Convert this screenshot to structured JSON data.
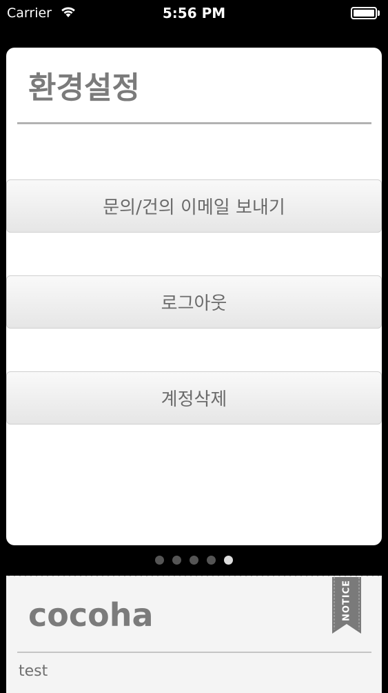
{
  "status_bar": {
    "carrier": "Carrier",
    "time": "5:56 PM"
  },
  "settings": {
    "title": "환경설정",
    "buttons": [
      {
        "label": "문의/건의 이메일 보내기"
      },
      {
        "label": "로그아웃"
      },
      {
        "label": "계정삭제"
      }
    ]
  },
  "pager": {
    "count": 5,
    "active_index": 4
  },
  "notice": {
    "title": "cocoha",
    "ribbon": "NOTICE",
    "body": "test"
  },
  "colors": {
    "background": "#000000",
    "card": "#ffffff",
    "title_text": "#7b7b7b",
    "button_text": "#6a6a6a"
  }
}
